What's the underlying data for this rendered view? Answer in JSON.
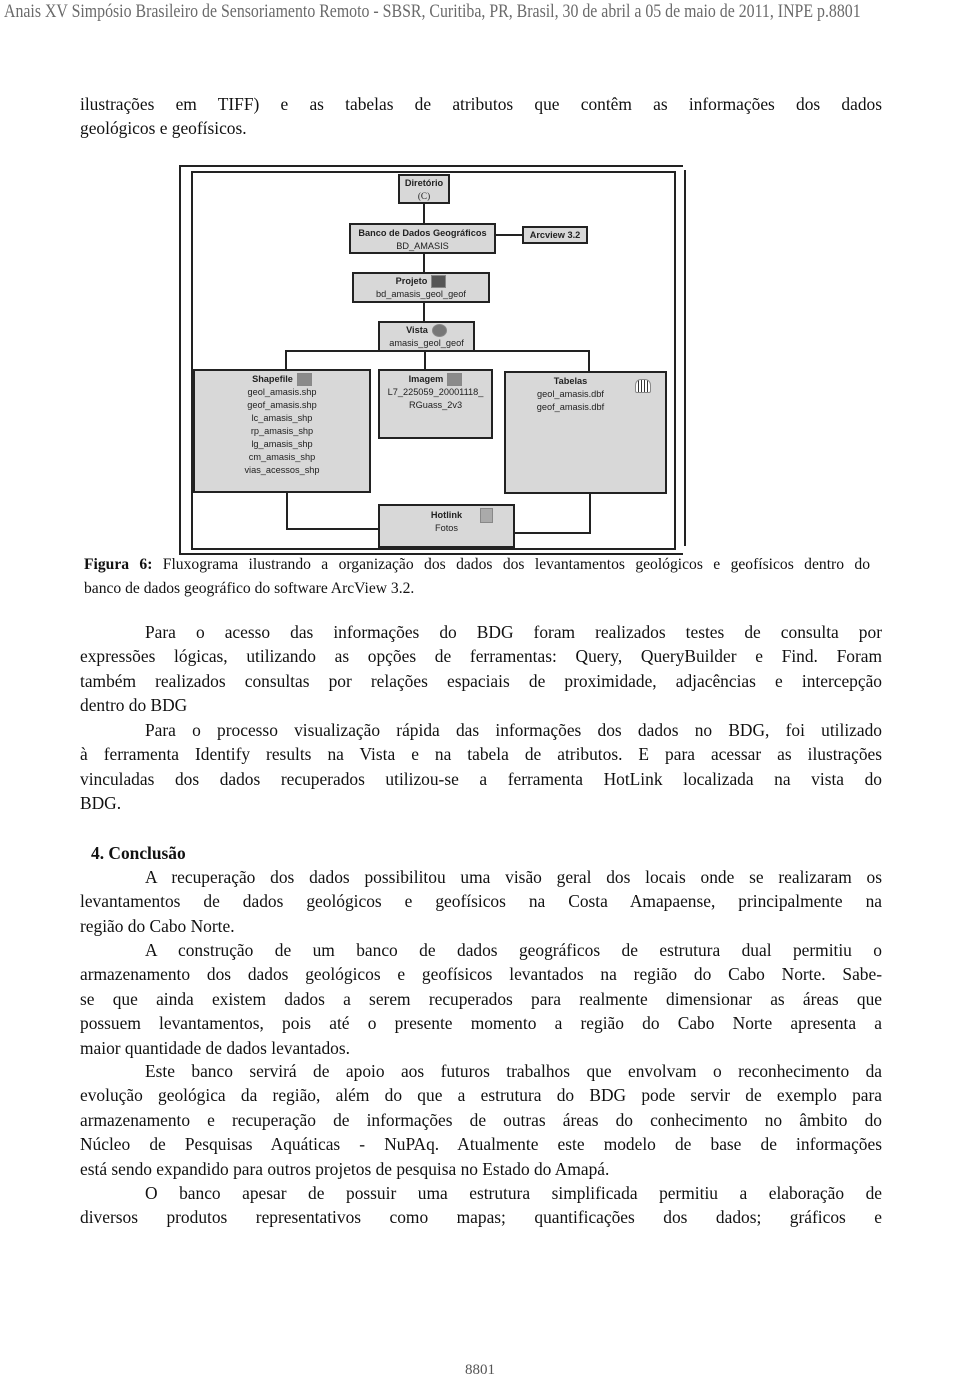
{
  "header": "Anais XV Simpósio Brasileiro de Sensoriamento Remoto - SBSR, Curitiba, PR, Brasil, 30 de abril a 05 de maio de 2011, INPE  p.8801",
  "intro_lines": [
    "ilustrações em TIFF) e as tabelas de atributos que contêm as informações dos dados",
    "geológicos e geofísicos."
  ],
  "diagram": {
    "diretorio": {
      "title": "Diretório",
      "sub": "(C)"
    },
    "banco": {
      "title": "Banco de Dados Geográficos",
      "sub": "BD_AMASIS"
    },
    "arcview": "Arcview 3.2",
    "projeto": {
      "title": "Projeto",
      "sub": "bd_amasis_geol_geof",
      "icon": "magnifier-icon"
    },
    "vista": {
      "title": "Vista",
      "sub": "amasis_geol_geof",
      "icon": "eye-icon"
    },
    "shapefile": {
      "title": "Shapefile",
      "items": [
        "geol_amasis.shp",
        "geof_amasis.shp",
        "lc_amasis_shp",
        "rp_amasis_shp",
        "lg_amasis_shp",
        "cm_amasis_shp",
        "vias_acessos_shp"
      ]
    },
    "imagem": {
      "title": "Imagem",
      "items": [
        "L7_225059_20001118_",
        "RGuass_2v3"
      ]
    },
    "tabelas": {
      "title": "Tabelas",
      "items": [
        "geol_amasis.dbf",
        "geof_amasis.dbf"
      ]
    },
    "hotlink": {
      "title": "Hotlink",
      "sub": "Fotos"
    }
  },
  "caption": {
    "label": "Figura 6:",
    "lines": [
      " Fluxograma ilustrando a organização dos dados dos levantamentos geológicos e geofísicos dentro do",
      "banco de dados geográfico do software ArcView 3.2."
    ]
  },
  "section": {
    "heading": "4. Conclusão"
  },
  "paragraphs": [
    [
      "Para o acesso das informações do BDG foram realizados testes de consulta por",
      "expressões lógicas, utilizando as opções de ferramentas: Query, QueryBuilder e Find. Foram",
      "também realizados consultas por relações espaciais de proximidade, adjacências e intercepção",
      "dentro do BDG"
    ],
    [
      "Para o processo visualização rápida das informações dos dados no BDG, foi utilizado",
      "à ferramenta Identify results na Vista e na tabela de atributos. E para acessar as ilustrações",
      "vinculadas dos dados recuperados utilizou-se a ferramenta HotLink localizada na vista do",
      "BDG."
    ],
    [
      "A recuperação dos dados possibilitou uma visão geral dos locais onde se realizaram os",
      "levantamentos de dados geológicos e geofísicos na Costa Amapaense, principalmente na",
      "região do Cabo Norte."
    ],
    [
      "A construção de um banco de dados geográficos de estrutura dual permitiu o",
      "armazenamento dos dados geológicos e geofísicos levantados na região do Cabo Norte. Sabe-",
      "se que ainda existem dados a serem recuperados para realmente dimensionar as áreas que",
      "possuem levantamentos, pois até o presente momento a região do Cabo Norte apresenta a",
      "maior quantidade de dados levantados."
    ],
    [
      "Este banco servirá de apoio aos futuros trabalhos que envolvam o reconhecimento da",
      "evolução geológica da região, além do que a estrutura do BDG pode servir de exemplo para",
      "armazenamento e recuperação de informações de outras áreas do conhecimento no âmbito do",
      "Núcleo de Pesquisas Aquáticas - NuPAq. Atualmente este modelo de base de informações",
      "está sendo expandido para outros projetos de pesquisa no Estado do Amapá."
    ],
    [
      "O banco apesar de possuir uma estrutura simplificada permitiu a elaboração de",
      "diversos produtos representativos como mapas; quantificações dos dados; gráficos e"
    ]
  ],
  "footer": "8801"
}
